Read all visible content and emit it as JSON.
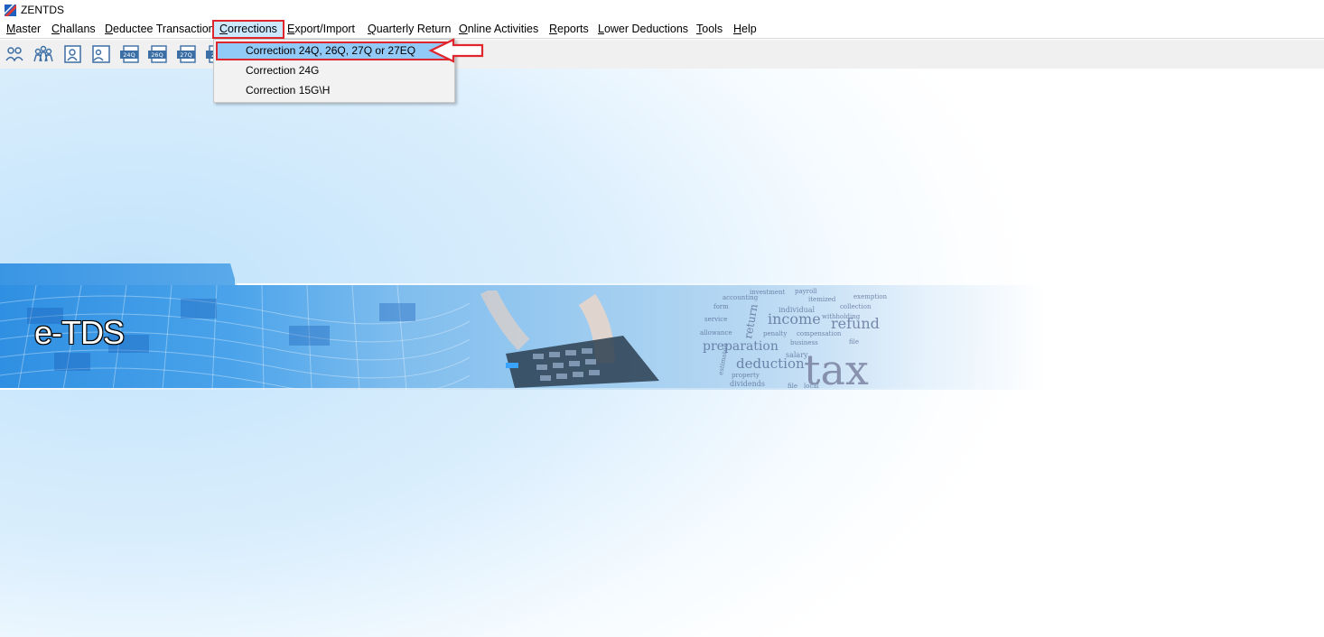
{
  "window": {
    "title": "ZENTDS"
  },
  "menubar": {
    "items": [
      {
        "label": "Master"
      },
      {
        "label": "Challans"
      },
      {
        "label": "Deductee Transaction"
      },
      {
        "label": "Corrections",
        "active": true
      },
      {
        "label": "Export/Import"
      },
      {
        "label": "Quarterly Return"
      },
      {
        "label": "Online Activities"
      },
      {
        "label": "Reports"
      },
      {
        "label": "Lower Deductions"
      },
      {
        "label": "Tools"
      },
      {
        "label": "Help"
      }
    ]
  },
  "toolbar": {
    "buttons": [
      {
        "icon": "users-icon"
      },
      {
        "icon": "group-icon"
      },
      {
        "icon": "deductee-icon"
      },
      {
        "icon": "employee-icon"
      },
      {
        "icon": "form-24q-icon",
        "label": "24Q"
      },
      {
        "icon": "form-26q-icon",
        "label": "26Q"
      },
      {
        "icon": "form-27q-icon",
        "label": "27Q"
      },
      {
        "icon": "form-27eq-icon",
        "label": "27"
      }
    ]
  },
  "corrections_menu": {
    "items": [
      {
        "label": "Correction 24Q, 26Q, 27Q or 27EQ",
        "highlighted": true
      },
      {
        "label": "Correction 24G"
      },
      {
        "label": "Correction 15G\\H"
      }
    ]
  },
  "banner": {
    "title": "e-TDS",
    "wordcloud": [
      "income",
      "refund",
      "preparation",
      "deduction",
      "tax",
      "return",
      "payroll",
      "itemized",
      "accounting",
      "investment",
      "individual",
      "collection",
      "penalty",
      "compensation",
      "salary",
      "dividends",
      "allowance",
      "property",
      "local",
      "file",
      "withholding",
      "exemption",
      "business",
      "contributions",
      "estimated",
      "form",
      "service"
    ]
  },
  "colors": {
    "highlight_border": "#e0262d",
    "menu_hover": "#cce8ff",
    "dropdown_highlight": "#91c9f7",
    "banner_blue": "#2f8fe2"
  }
}
